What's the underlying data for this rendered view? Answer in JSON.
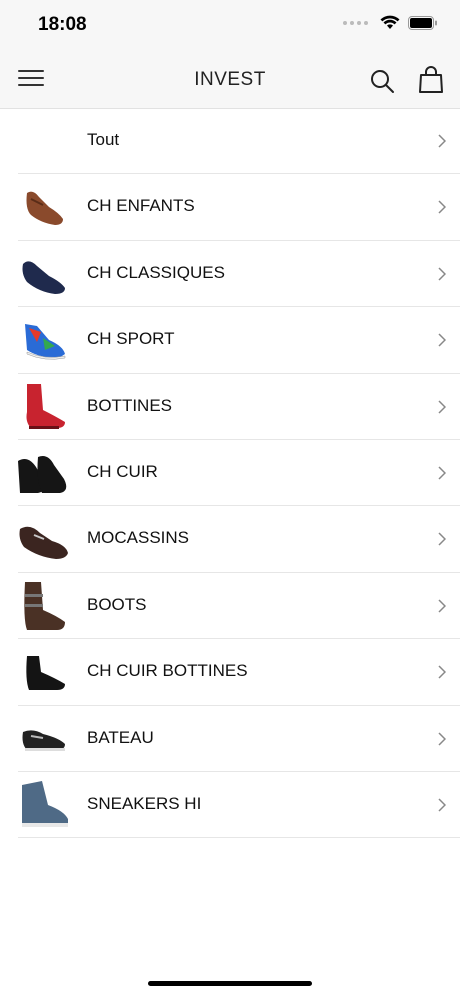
{
  "status": {
    "time": "18:08"
  },
  "nav": {
    "title": "INVEST"
  },
  "categories": [
    {
      "label": "Tout",
      "thumb": "none"
    },
    {
      "label": "CH ENFANTS",
      "thumb": "brown-derby-shoe",
      "color": "#8a4a2c"
    },
    {
      "label": "CH CLASSIQUES",
      "thumb": "navy-suede-loafer",
      "color": "#1f2a4d"
    },
    {
      "label": "CH SPORT",
      "thumb": "multicolor-sneaker",
      "color": "#2a6bd6"
    },
    {
      "label": "BOTTINES",
      "thumb": "red-chelsea-boot",
      "color": "#c8232f"
    },
    {
      "label": "CH CUIR",
      "thumb": "black-velvet-loafers",
      "color": "#151515"
    },
    {
      "label": "MOCASSINS",
      "thumb": "dark-brown-moccasin",
      "color": "#3b2520"
    },
    {
      "label": "BOOTS",
      "thumb": "brown-buckle-boot",
      "color": "#4a3125"
    },
    {
      "label": "CH CUIR BOTTINES",
      "thumb": "black-leather-ankle-boot",
      "color": "#141414"
    },
    {
      "label": "BATEAU",
      "thumb": "black-boat-shoe",
      "color": "#222222"
    },
    {
      "label": "SNEAKERS HI",
      "thumb": "blue-high-top-sneaker",
      "color": "#4f6a86"
    }
  ]
}
